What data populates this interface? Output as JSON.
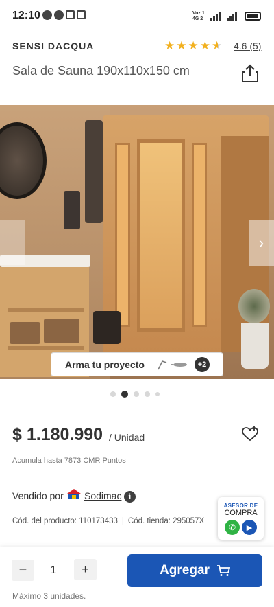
{
  "status_bar": {
    "time": "12:10",
    "network_text_top": "Voz 1",
    "network_text_bottom": "4G 2"
  },
  "product": {
    "brand": "SENSI DACQUA",
    "rating": 4.6,
    "rating_text": "4.6 (5)",
    "title": "Sala de Sauna 190x110x150 cm",
    "price": "$ 1.180.990",
    "price_unit": "/ Unidad",
    "points": "Acumula hasta 7873 CMR Puntos",
    "sold_by_label": "Vendido por",
    "seller": "Sodimac",
    "product_code": "Cód. del producto: 110173433",
    "store_code": "Cód. tienda: 295057X"
  },
  "gallery": {
    "project_label": "Arma tu proyecto",
    "extra_count": "+2",
    "current_index": 2,
    "total": 5
  },
  "advisor": {
    "line1": "ASESOR DE",
    "line2": "COMPRA"
  },
  "cart": {
    "minus": "−",
    "quantity": "1",
    "plus": "+",
    "add_label": "Agregar",
    "max_units": "Máximo 3 unidades."
  },
  "colors": {
    "primary": "#1b56b5",
    "star": "#f2b01e",
    "whatsapp": "#2fb344"
  }
}
